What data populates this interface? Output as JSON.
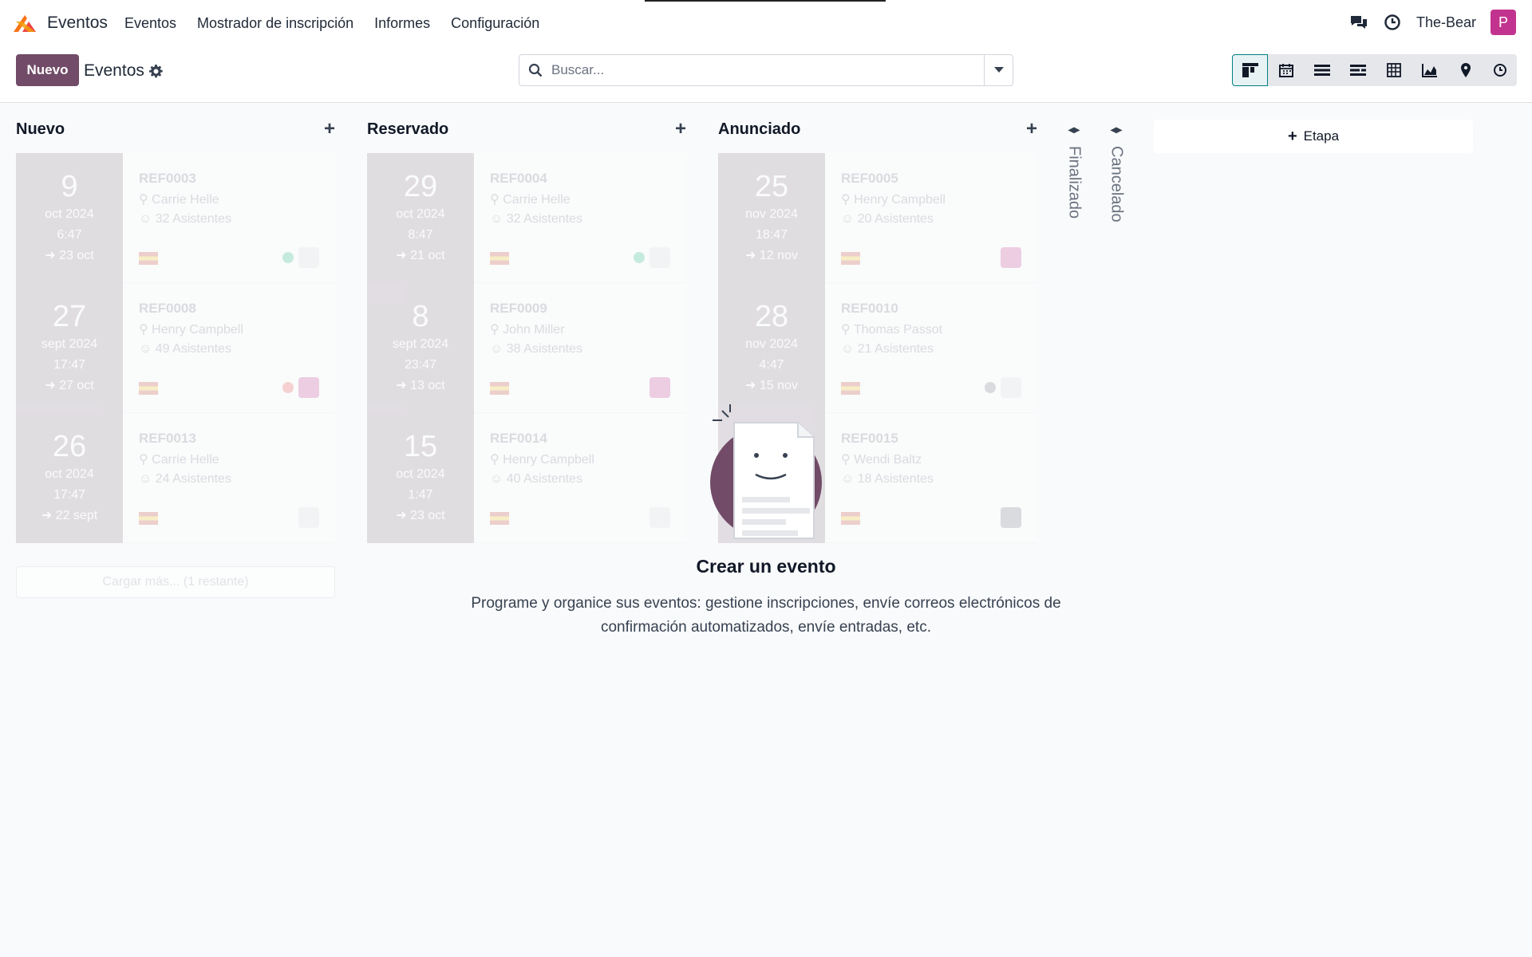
{
  "navbar": {
    "app_name": "Eventos",
    "menu": [
      "Eventos",
      "Mostrador de inscripción",
      "Informes",
      "Configuración"
    ],
    "user": "The-Bear",
    "avatar_letter": "P"
  },
  "control_panel": {
    "new_label": "Nuevo",
    "breadcrumb": "Eventos",
    "search_placeholder": "Buscar..."
  },
  "kanban": {
    "columns": [
      {
        "title": "Nuevo",
        "cards": [
          {
            "day": "9",
            "month": "oct 2024",
            "time": "6:47",
            "end": "23 oct",
            "ref": "REF0003",
            "location": "Carrie Helle",
            "attendees": "32 Asistentes"
          },
          {
            "day": "27",
            "month": "sept 2024",
            "time": "17:47",
            "end": "27 oct",
            "ref": "REF0008",
            "location": "Henry Campbell",
            "attendees": "49 Asistentes"
          },
          {
            "day": "26",
            "month": "oct 2024",
            "time": "17:47",
            "end": "22 sept",
            "ref": "REF0013",
            "location": "Carrie Helle",
            "attendees": "24 Asistentes"
          }
        ],
        "load_more": "Cargar más... (1 restante)"
      },
      {
        "title": "Reservado",
        "cards": [
          {
            "day": "29",
            "month": "oct 2024",
            "time": "8:47",
            "end": "21 oct",
            "ref": "REF0004",
            "location": "Carrie Helle",
            "attendees": "32 Asistentes"
          },
          {
            "day": "8",
            "month": "sept 2024",
            "time": "23:47",
            "end": "13 oct",
            "ref": "REF0009",
            "location": "John Miller",
            "attendees": "38 Asistentes"
          },
          {
            "day": "15",
            "month": "oct 2024",
            "time": "1:47",
            "end": "23 oct",
            "ref": "REF0014",
            "location": "Henry Campbell",
            "attendees": "40 Asistentes"
          }
        ]
      },
      {
        "title": "Anunciado",
        "cards": [
          {
            "day": "25",
            "month": "nov 2024",
            "time": "18:47",
            "end": "12 nov",
            "ref": "REF0005",
            "location": "Henry Campbell",
            "attendees": "20 Asistentes"
          },
          {
            "day": "28",
            "month": "nov 2024",
            "time": "4:47",
            "end": "15 nov",
            "ref": "REF0010",
            "location": "Thomas Passot",
            "attendees": "21 Asistentes"
          },
          {
            "day": "",
            "month": "",
            "time": "",
            "end": "",
            "ref": "REF0015",
            "location": "Wendi Baltz",
            "attendees": "18 Asistentes"
          }
        ]
      }
    ],
    "folded": [
      "Finalizado",
      "Cancelado"
    ],
    "add_stage": "Etapa"
  },
  "empty_state": {
    "title": "Crear un evento",
    "text_line1": "Programe y organice sus eventos: gestione inscripciones, envíe correos electrónicos de",
    "text_line2": "confirmación automatizados, envíe entradas, etc."
  },
  "colors": {
    "brand": "#714b67",
    "accent": "#017e84",
    "avatar": "#c2338f"
  }
}
